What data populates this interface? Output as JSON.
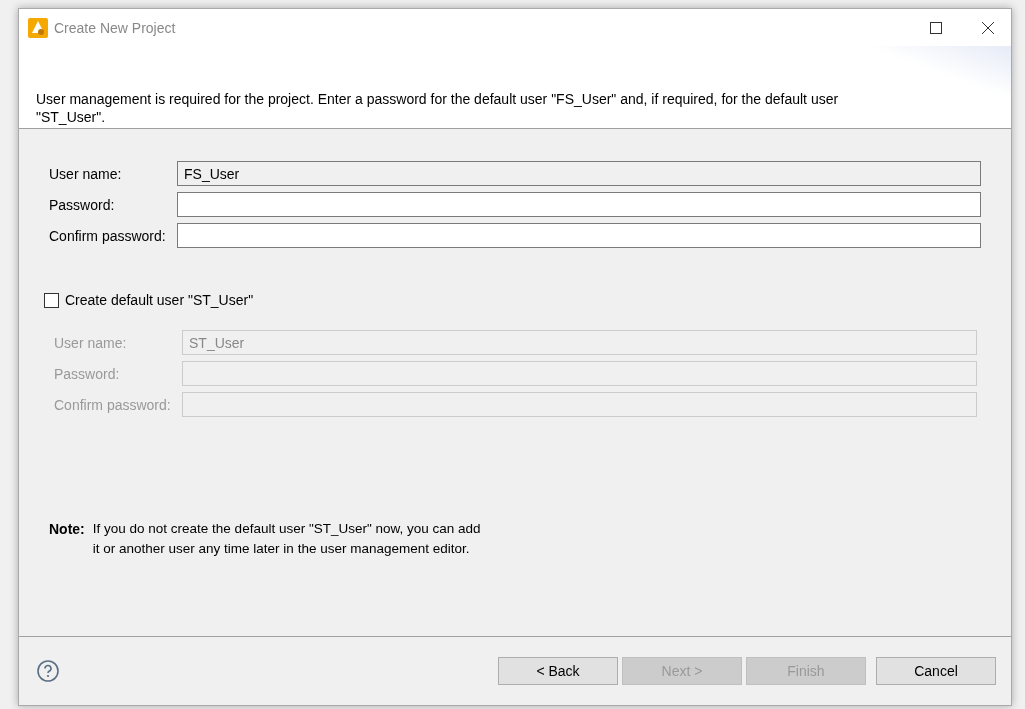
{
  "window": {
    "title": "Create New Project"
  },
  "header": {
    "message": "User management is required for the project. Enter a password for the default user \"FS_User\" and, if required, for the default user \"ST_User\"."
  },
  "primary_fields": [
    {
      "label": "User name:",
      "value": "FS_User",
      "readonly": true,
      "disabled": false
    },
    {
      "label": "Password:",
      "readonly": false,
      "disabled": false
    },
    {
      "label": "Confirm password:",
      "readonly": false,
      "disabled": false
    }
  ],
  "create_default_user": {
    "label": "Create default user \"ST_User\"",
    "checked": false
  },
  "secondary_fields": [
    {
      "label": "User name:",
      "value": "ST_User",
      "disabled": true
    },
    {
      "label": "Password:",
      "disabled": true
    },
    {
      "label": "Confirm password:",
      "disabled": true
    }
  ],
  "note": {
    "label": "Note:",
    "text": "If you do not create the default user \"ST_User\" now, you can add it or another user any time later in the user management editor."
  },
  "buttons": [
    {
      "label": "< Back",
      "disabled": false
    },
    {
      "label": "Next >",
      "disabled": true
    },
    {
      "label": "Finish",
      "disabled": true
    },
    {
      "label": "Cancel",
      "disabled": false
    }
  ]
}
